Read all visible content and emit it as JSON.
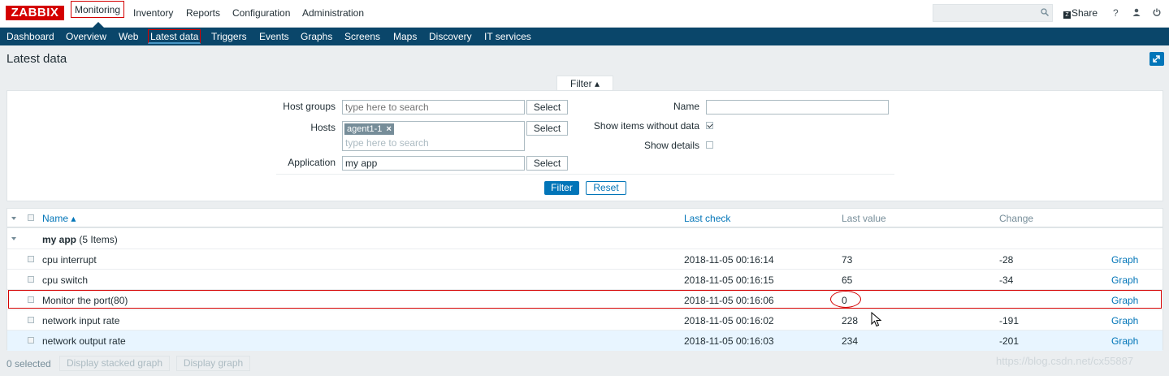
{
  "header": {
    "logo": "ZABBIX",
    "menu": [
      "Monitoring",
      "Inventory",
      "Reports",
      "Configuration",
      "Administration"
    ],
    "active_menu": "Monitoring",
    "search_placeholder": "",
    "share_label": "Share",
    "share_badge": "Z",
    "help_label": "?",
    "user_icon": "user-icon",
    "logout_icon": "power-icon"
  },
  "subnav": [
    "Dashboard",
    "Overview",
    "Web",
    "Latest data",
    "Triggers",
    "Events",
    "Graphs",
    "Screens",
    "Maps",
    "Discovery",
    "IT services"
  ],
  "page": {
    "title": "Latest data"
  },
  "filter": {
    "tab_label": "Filter ▴",
    "host_groups_label": "Host groups",
    "host_groups_placeholder": "type here to search",
    "hosts_label": "Hosts",
    "hosts_tag": "agent1-1",
    "hosts_placeholder": "type here to search",
    "application_label": "Application",
    "application_value": "my app",
    "select_label": "Select",
    "name_label": "Name",
    "name_value": "",
    "show_without_data_label": "Show items without data",
    "show_without_data": true,
    "show_details_label": "Show details",
    "show_details": false,
    "filter_button": "Filter",
    "reset_button": "Reset"
  },
  "table": {
    "headers": {
      "name": "Name ▴",
      "last_check": "Last check",
      "last_value": "Last value",
      "change": "Change"
    },
    "group": {
      "name": "my app",
      "count": "(5 Items)"
    },
    "rows": [
      {
        "name": "cpu interrupt",
        "last_check": "2018-11-05 00:16:14",
        "last_value": "73",
        "change": "-28",
        "action": "Graph"
      },
      {
        "name": "cpu switch",
        "last_check": "2018-11-05 00:16:15",
        "last_value": "65",
        "change": "-34",
        "action": "Graph"
      },
      {
        "name": "Monitor the port(80)",
        "last_check": "2018-11-05 00:16:06",
        "last_value": "0",
        "change": "",
        "action": "Graph"
      },
      {
        "name": "network input rate",
        "last_check": "2018-11-05 00:16:02",
        "last_value": "228",
        "change": "-191",
        "action": "Graph"
      },
      {
        "name": "network output rate",
        "last_check": "2018-11-05 00:16:03",
        "last_value": "234",
        "change": "-201",
        "action": "Graph"
      }
    ]
  },
  "footer": {
    "selected": "0 selected",
    "stacked_button": "Display stacked graph",
    "graph_button": "Display graph"
  },
  "watermark": "https://blog.csdn.net/cx55887",
  "colors": {
    "accent": "#0275b8",
    "nav": "#0a466a",
    "logo": "#d40000"
  }
}
